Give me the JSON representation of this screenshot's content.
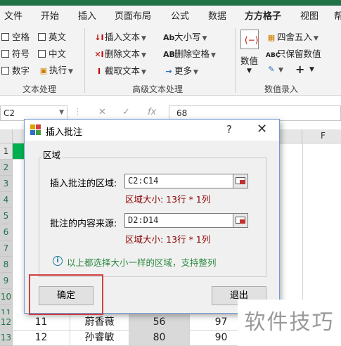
{
  "ribbon": {
    "tabs": [
      "文件",
      "开始",
      "插入",
      "页面布局",
      "公式",
      "数据",
      "方方格子",
      "视图",
      "帮"
    ],
    "active_tab": "方方格子",
    "checkboxes": [
      "空格",
      "英文",
      "符号",
      "中文",
      "数字",
      "执行"
    ],
    "group_text": "文本处理",
    "group_advanced": "高级文本处理",
    "group_number": "数值录入",
    "insert_text": "插入文本",
    "delete_text": "删除文本",
    "cut_text": "截取文本",
    "case": "大小写",
    "delete_space": "删除空格",
    "more": "更多",
    "number_label": "数值",
    "round": "四舍五入",
    "keep_number": "只保留数值"
  },
  "formula_bar": {
    "name_box": "C2",
    "fx": "fx",
    "value": "68"
  },
  "grid": {
    "col_f": "F",
    "row_headers": [
      "1",
      "2",
      "3",
      "4",
      "5",
      "6",
      "7",
      "8",
      "9",
      "10",
      "11",
      "12",
      "13"
    ],
    "row12": [
      "11",
      "蔚香薇",
      "56",
      "97"
    ],
    "row13": [
      "12",
      "孙睿敏",
      "80",
      "90"
    ]
  },
  "dialog": {
    "title": "插入批注",
    "help": "?",
    "close": "✕",
    "legend": "区域",
    "label_region": "插入批注的区域:",
    "value_region": "C2:C14",
    "size_region": "区域大小: 13行 * 1列",
    "label_source": "批注的内容来源:",
    "value_source": "D2:D14",
    "size_source": "区域大小: 13行 * 1列",
    "info": "以上都选择大小一样的区域，支持整列",
    "ok": "确定",
    "exit": "退出"
  },
  "watermark": "软件技巧"
}
